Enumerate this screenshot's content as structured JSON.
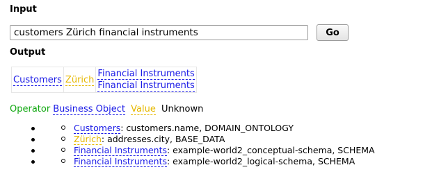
{
  "input": {
    "heading": "Input",
    "query_value": "customers Zürich financial instruments",
    "go_label": "Go"
  },
  "output": {
    "heading": "Output",
    "table": {
      "col1": "Customers",
      "col2": "Zürich",
      "col3_line1": "Financial Instruments",
      "col3_line2": "Financial Instruments"
    }
  },
  "legend": {
    "operator": "Operator",
    "business_object": "Business Object",
    "value": "Value",
    "unknown": "Unknown"
  },
  "results": [
    {
      "term": "Customers",
      "type": "business_object",
      "detail": ": customers.name, DOMAIN_ONTOLOGY"
    },
    {
      "term": "Zürich",
      "type": "value",
      "detail": ": addresses.city, BASE_DATA"
    },
    {
      "term": "Financial Instruments",
      "type": "business_object",
      "detail": ": example-world2_conceptual-schema, SCHEMA"
    },
    {
      "term": "Financial Instruments",
      "type": "business_object",
      "detail": ": example-world2_logical-schema, SCHEMA"
    }
  ],
  "colors": {
    "operator": "#11a811",
    "business_object": "#1a1ae6",
    "value": "#e6b800",
    "unknown": "#000000"
  }
}
